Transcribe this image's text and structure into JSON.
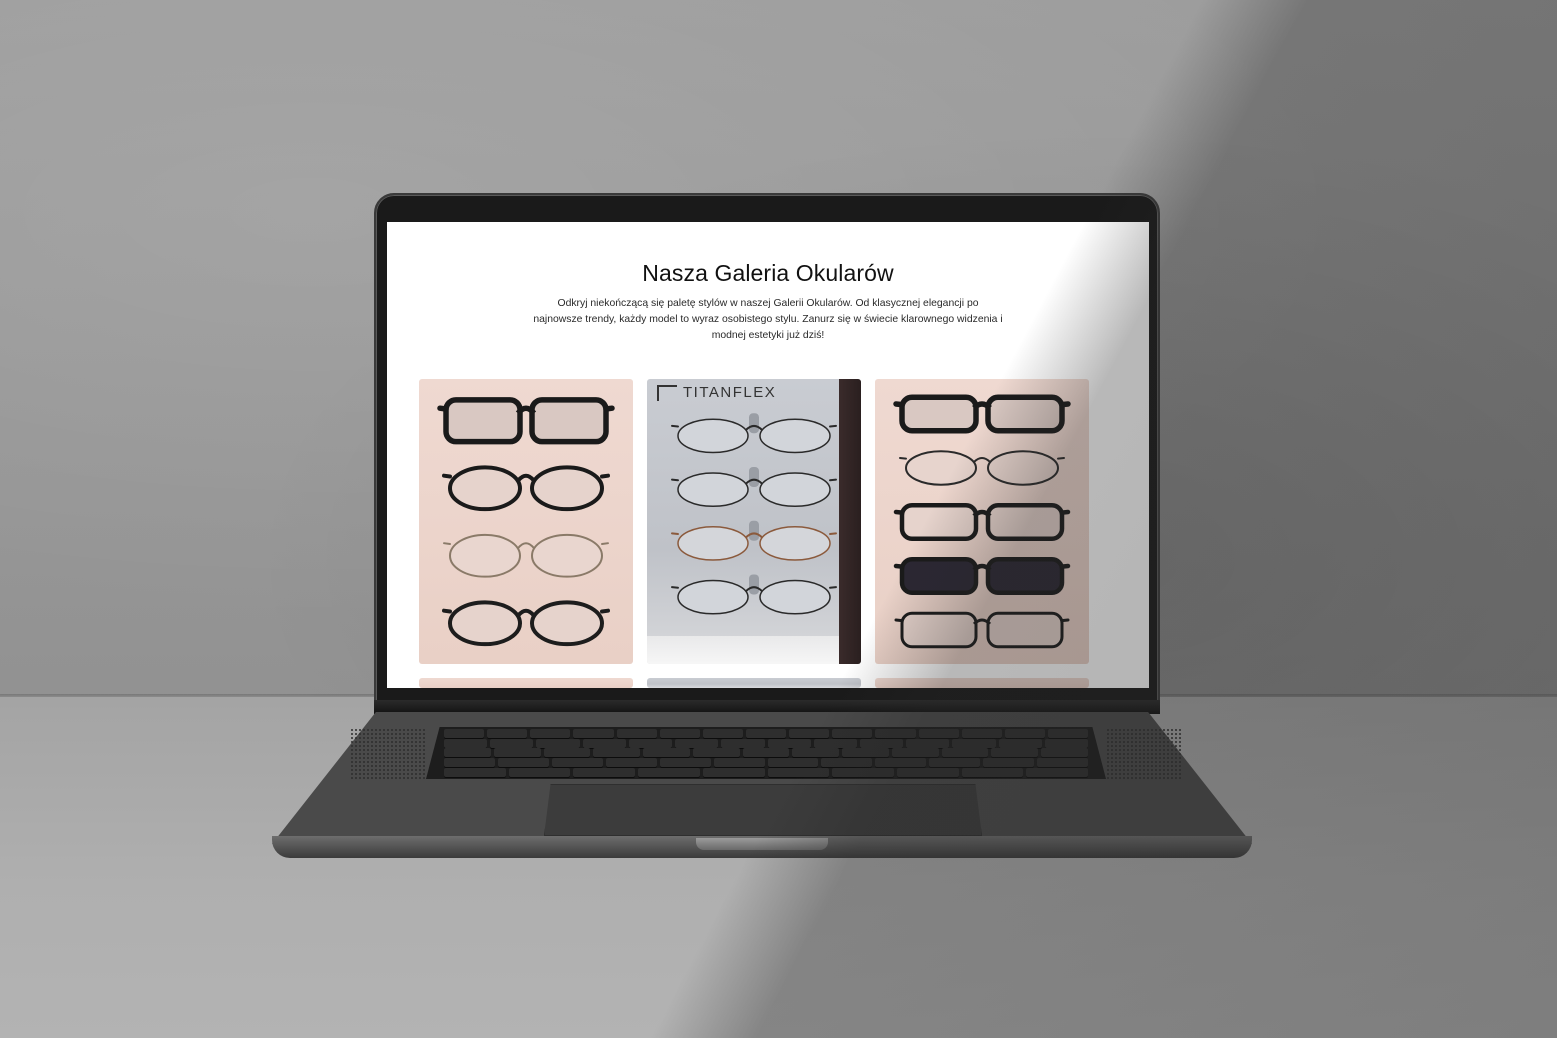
{
  "page": {
    "title": "Nasza Galeria Okularów",
    "intro": "Odkryj niekończącą się paletę stylów w naszej Galerii Okularów. Od klasycznej elegancji po najnowsze trendy, każdy model to wyraz osobistego stylu. Zanurz się w świecie klarownego widzenia i modnej estetyki już dziś!"
  },
  "gallery": {
    "photos": [
      {
        "label": "gallery-photo-1",
        "background": "pink",
        "frames": [
          "square-black",
          "round-black",
          "round-tan",
          "round-black-large"
        ]
      },
      {
        "label": "gallery-photo-2",
        "background": "grey",
        "brand": "TITANFLEX",
        "frames": [
          "round-metal",
          "round-metal",
          "round-bronze",
          "round-metal"
        ]
      },
      {
        "label": "gallery-photo-3",
        "background": "pink",
        "frames": [
          "square-black",
          "round-metal-dark",
          "rect-black",
          "rect-sun-clip",
          "rect-black-thin"
        ]
      }
    ]
  },
  "colors": {
    "accent_text": "#111111",
    "screen_bg": "#ffffff"
  }
}
